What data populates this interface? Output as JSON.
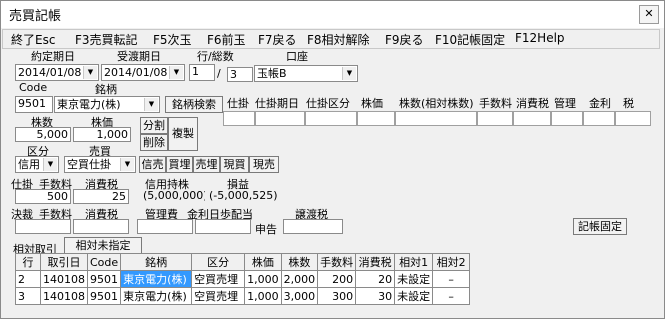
{
  "window": {
    "title": "売買記帳",
    "close_glyph": "✕"
  },
  "menu": [
    "終了Esc",
    "F3売買転記",
    "F5次玉",
    "F6前玉",
    "F7戻る",
    "F8相対解除",
    "F9戻る",
    "F10記帳固定",
    "F12Help"
  ],
  "form": {
    "contract_date_label": "約定期日",
    "contract_date": "2014/01/08",
    "delivery_date_label": "受渡期日",
    "delivery_date": "2014/01/08",
    "row_total_label": "行/総数",
    "row_num": "1",
    "slash": "/",
    "row_total": "3",
    "account_label": "口座",
    "account": "玉帳B",
    "code_label": "Code",
    "code": "9501",
    "name_label": "銘柄",
    "name": "東京電力(株)",
    "search_button": "銘柄検索",
    "shares_label": "株数",
    "shares": "5,000",
    "price_label": "株価",
    "price": "1,000",
    "split_button": "分割",
    "delete_button": "削除",
    "copy_button": "複製",
    "category_label": "区分",
    "category": "信用",
    "trade_label": "売買",
    "trade": "空買仕掛",
    "trade_buttons": [
      "信売",
      "買埋",
      "売埋",
      "現買",
      "現売"
    ],
    "fee_row": {
      "label1": "仕掛",
      "label2": "手数料",
      "label3": "消費税",
      "label4": "信用持株",
      "label5": "損益",
      "fee": "500",
      "tax": "25",
      "holding": "(5,000,000)",
      "pnl": "(-5,000,525)"
    },
    "settle_row": {
      "label1": "決裁",
      "label2": "手数料",
      "label3": "消費税",
      "label4": "管理費",
      "label5": "金利日歩配当",
      "label6": "申告",
      "label7": "譲渡税"
    },
    "record_fix_button": "記帳固定"
  },
  "right_grid_headers": [
    "仕掛",
    "仕掛期日",
    "仕掛区分",
    "株価",
    "株数(相対株数)",
    "手数料",
    "消費税",
    "管理",
    "金利",
    "税"
  ],
  "tabs": [
    "相対取引",
    "相対未指定"
  ],
  "table": {
    "columns": [
      "行",
      "取引日",
      "Code",
      "銘柄",
      "区分",
      "株価",
      "株数",
      "手数料",
      "消費税",
      "相対1",
      "相対2"
    ],
    "rows": [
      [
        "2",
        "140108",
        "9501",
        "東京電力(株)",
        "空買売埋",
        "1,000",
        "2,000",
        "200",
        "20",
        "未設定",
        "–"
      ],
      [
        "3",
        "140108",
        "9501",
        "東京電力(株)",
        "空買売埋",
        "1,000",
        "3,000",
        "300",
        "30",
        "未設定",
        "–"
      ]
    ]
  }
}
